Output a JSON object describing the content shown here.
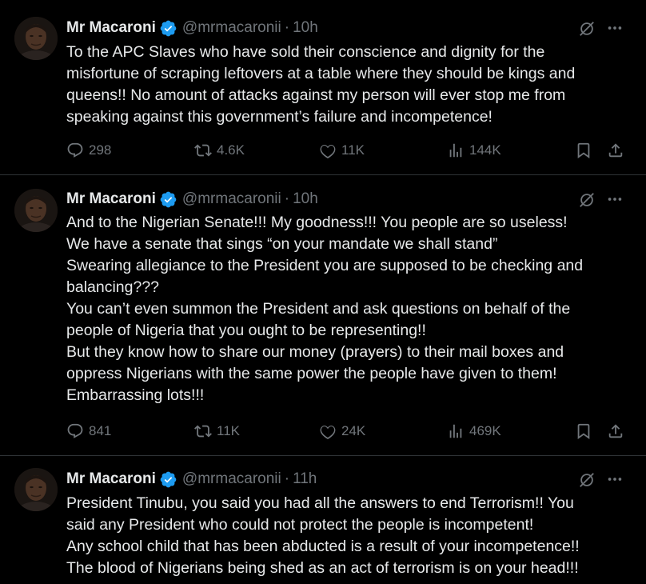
{
  "tweets": [
    {
      "author": {
        "name": "Mr Macaroni",
        "handle": "@mrmacaronii",
        "dot": "·",
        "time": "10h"
      },
      "text_lines": [
        "To the APC Slaves who have sold their conscience and dignity for the",
        "misfortune of scraping leftovers at a table where they should be kings and",
        "queens!! No amount of attacks against my person will ever stop me from",
        "speaking against this government’s failure and incompetence!"
      ],
      "stats": {
        "replies": "298",
        "reposts": "4.6K",
        "likes": "11K",
        "views": "144K"
      }
    },
    {
      "author": {
        "name": "Mr Macaroni",
        "handle": "@mrmacaronii",
        "dot": "·",
        "time": "10h"
      },
      "text_lines": [
        "And to the Nigerian Senate!!! My goodness!!! You people are so useless!",
        "We have a senate that sings “on your mandate we shall stand”",
        "Swearing allegiance to the President you are supposed to be checking and",
        "balancing???",
        "You can’t even summon the President and ask questions on behalf of the",
        "people of Nigeria that you ought to be representing!!",
        "But they know how to share our money (prayers) to their mail boxes and",
        "oppress Nigerians with the same power the people have given to them!",
        "Embarrassing lots!!!"
      ],
      "stats": {
        "replies": "841",
        "reposts": "11K",
        "likes": "24K",
        "views": "469K"
      }
    },
    {
      "author": {
        "name": "Mr Macaroni",
        "handle": "@mrmacaronii",
        "dot": "·",
        "time": "11h"
      },
      "text_lines": [
        "President Tinubu, you said you had all the answers to end Terrorism!! You",
        "said any President who could not protect the people is incompetent!",
        "Any school child that has been abducted is a result of your incompetence!!",
        "The blood of Nigerians being shed as an act of terrorism is on your head!!!"
      ],
      "stats": null
    }
  ],
  "colors": {
    "background": "#000000",
    "text_primary": "#e7e9ea",
    "text_secondary": "#71767b",
    "divider": "#2f3336",
    "verified_blue": "#1d9bf0"
  },
  "icons": {
    "verified": "verified-badge-icon",
    "grok": "grok-icon",
    "more": "more-icon",
    "reply": "reply-icon",
    "repost": "repost-icon",
    "like": "like-icon",
    "views": "views-icon",
    "bookmark": "bookmark-icon",
    "share": "share-icon"
  }
}
